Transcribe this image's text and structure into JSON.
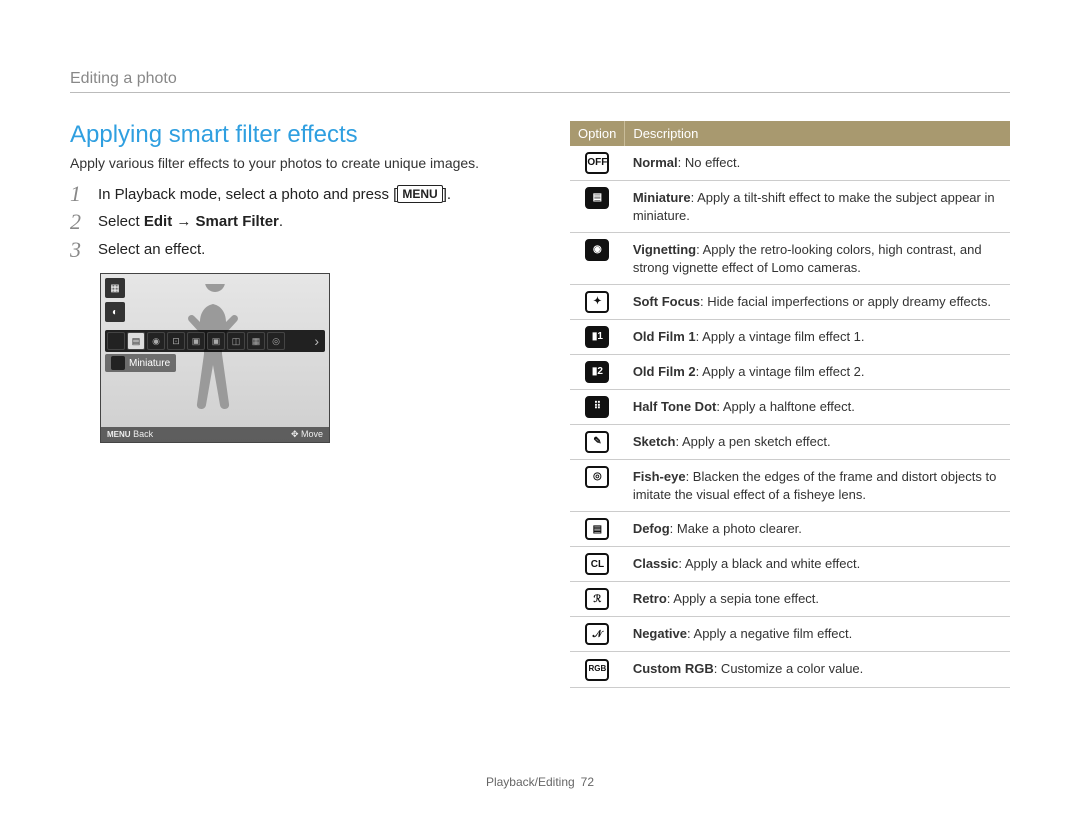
{
  "breadcrumb": "Editing a photo",
  "title": "Applying smart filter effects",
  "intro": "Apply various filter effects to your photos to create unique images.",
  "steps": {
    "s1_a": "In Playback mode, select a photo and press [",
    "s1_menu": "MENU",
    "s1_b": "].",
    "s2_a": "Select ",
    "s2_bold": "Edit → Smart Filter",
    "s2_b": ".",
    "s3": "Select an effect."
  },
  "cam": {
    "selected_label": "Miniature",
    "back": "Back",
    "move": "Move",
    "menu_key": "MENU"
  },
  "table": {
    "th_option": "Option",
    "th_desc": "Description"
  },
  "filters": [
    {
      "name": "Normal",
      "desc": ": No effect."
    },
    {
      "name": "Miniature",
      "desc": ": Apply a tilt-shift effect to make the subject appear in miniature."
    },
    {
      "name": "Vignetting",
      "desc": ": Apply the retro-looking colors, high contrast, and strong vignette effect of Lomo cameras."
    },
    {
      "name": "Soft Focus",
      "desc": ": Hide facial imperfections or apply dreamy effects."
    },
    {
      "name": "Old Film 1",
      "desc": ": Apply a vintage film effect 1."
    },
    {
      "name": "Old Film 2",
      "desc": ": Apply a vintage film effect 2."
    },
    {
      "name": "Half Tone Dot",
      "desc": ": Apply a halftone effect."
    },
    {
      "name": "Sketch",
      "desc": ": Apply a pen sketch effect."
    },
    {
      "name": "Fish-eye",
      "desc": ": Blacken the edges of the frame and distort objects to imitate the visual effect of a fisheye lens."
    },
    {
      "name": "Defog",
      "desc": ": Make a photo clearer."
    },
    {
      "name": "Classic",
      "desc": ": Apply a black and white effect."
    },
    {
      "name": "Retro",
      "desc": ": Apply a sepia tone effect."
    },
    {
      "name": "Negative",
      "desc": ": Apply a negative film effect."
    },
    {
      "name": "Custom RGB",
      "desc": ": Customize a color value."
    }
  ],
  "footer": {
    "section": "Playback/Editing",
    "page": "72"
  }
}
